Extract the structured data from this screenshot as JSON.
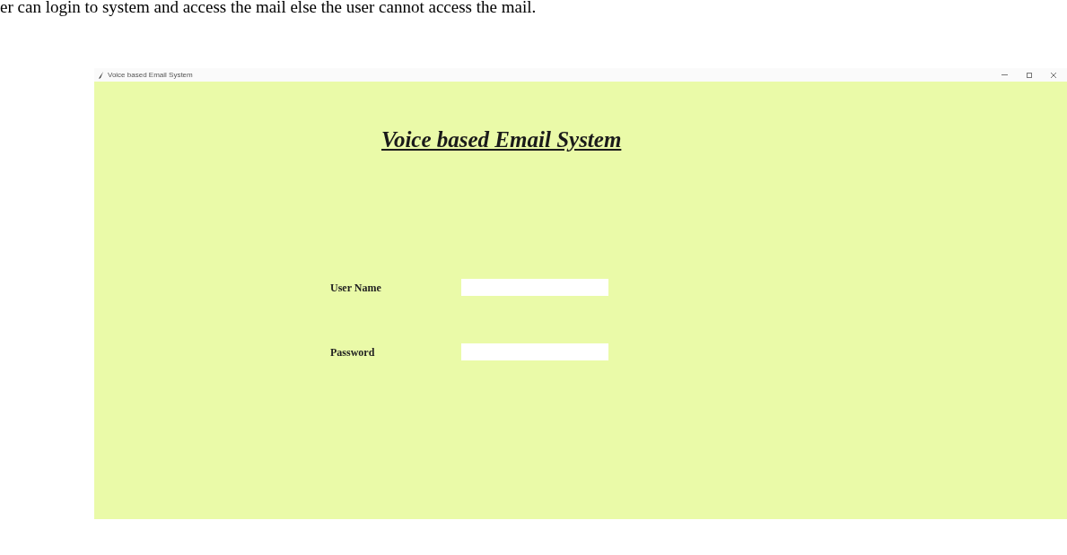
{
  "document_text": "er can login to system and access the mail else the user cannot access the mail.",
  "window": {
    "title": "Voice based Email System"
  },
  "heading": "Voice based Email System",
  "fields": [
    {
      "label": "User Name"
    },
    {
      "label": "Password"
    }
  ]
}
